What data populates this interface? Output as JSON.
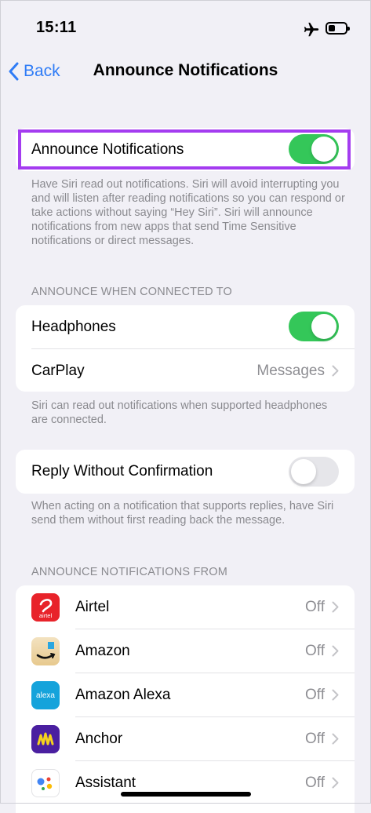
{
  "status_bar": {
    "time": "15:11",
    "airplane_icon": "airplane-icon",
    "battery_icon": "battery-icon"
  },
  "nav": {
    "back_label": "Back",
    "title": "Announce Notifications"
  },
  "main_toggle": {
    "label": "Announce Notifications",
    "on": true
  },
  "main_footer": "Have Siri read out notifications. Siri will avoid interrupting you and will listen after reading notifications so you can respond or take actions without saying “Hey Siri”. Siri will announce notifications from new apps that send Time Sensitive notifications or direct messages.",
  "connected_section": {
    "header": "ANNOUNCE WHEN CONNECTED TO",
    "headphones": {
      "label": "Headphones",
      "on": true
    },
    "carplay": {
      "label": "CarPlay",
      "value": "Messages"
    },
    "footer": "Siri can read out notifications when supported headphones are connected."
  },
  "reply_section": {
    "label": "Reply Without Confirmation",
    "on": false,
    "footer": "When acting on a notification that supports replies, have Siri send them without first reading back the message."
  },
  "apps_section": {
    "header": "ANNOUNCE NOTIFICATIONS FROM",
    "apps": [
      {
        "name": "Airtel",
        "value": "Off",
        "icon": "airtel-icon",
        "icon_text": "airtel"
      },
      {
        "name": "Amazon",
        "value": "Off",
        "icon": "amazon-icon"
      },
      {
        "name": "Amazon Alexa",
        "value": "Off",
        "icon": "alexa-icon",
        "icon_text": "alexa"
      },
      {
        "name": "Anchor",
        "value": "Off",
        "icon": "anchor-icon"
      },
      {
        "name": "Assistant",
        "value": "Off",
        "icon": "google-assistant-icon"
      }
    ]
  },
  "colors": {
    "accent": "#2f7cf6",
    "toggle_on": "#34c759",
    "highlight": "#a43cf0"
  }
}
